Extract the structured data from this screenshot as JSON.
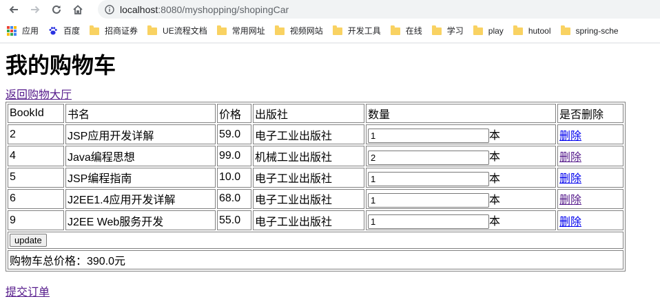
{
  "browser": {
    "url_host": "localhost",
    "url_path": ":8080/myshopping/shopingCar",
    "bookmarks": [
      {
        "label": "应用",
        "icon": "apps-icon"
      },
      {
        "label": "百度",
        "icon": "baidu-paw-icon"
      },
      {
        "label": "招商证券",
        "icon": "folder-icon"
      },
      {
        "label": "UE流程文档",
        "icon": "folder-icon"
      },
      {
        "label": "常用网址",
        "icon": "folder-icon"
      },
      {
        "label": "视频网站",
        "icon": "folder-icon"
      },
      {
        "label": "开发工具",
        "icon": "folder-icon"
      },
      {
        "label": "在线",
        "icon": "folder-icon"
      },
      {
        "label": "学习",
        "icon": "folder-icon"
      },
      {
        "label": "play",
        "icon": "folder-icon"
      },
      {
        "label": "hutool",
        "icon": "folder-icon"
      },
      {
        "label": "spring-sche",
        "icon": "folder-icon"
      }
    ]
  },
  "page": {
    "title": "我的购物车",
    "back_link": "返回购物大厅",
    "submit_link": "提交订单"
  },
  "table": {
    "headers": [
      "BookId",
      "书名",
      "价格",
      "出版社",
      "数量",
      "是否删除"
    ],
    "rows": [
      {
        "id": "2",
        "name": "JSP应用开发详解",
        "price": "59.0",
        "publisher": "电子工业出版社",
        "qty": "1",
        "unit": "本",
        "delete": "删除"
      },
      {
        "id": "4",
        "name": "Java编程思想",
        "price": "99.0",
        "publisher": "机械工业出版社",
        "qty": "2",
        "unit": "本",
        "delete": "删除"
      },
      {
        "id": "5",
        "name": "JSP编程指南",
        "price": "10.0",
        "publisher": "电子工业出版社",
        "qty": "1",
        "unit": "本",
        "delete": "删除"
      },
      {
        "id": "6",
        "name": "J2EE1.4应用开发详解",
        "price": "68.0",
        "publisher": "电子工业出版社",
        "qty": "1",
        "unit": "本",
        "delete": "删除"
      },
      {
        "id": "9",
        "name": "J2EE Web服务开发",
        "price": "55.0",
        "publisher": "电子工业出版社",
        "qty": "1",
        "unit": "本",
        "delete": "删除"
      }
    ],
    "update_label": "update",
    "total_text": "购物车总价格：390.0元"
  },
  "colors": {
    "visited_link": "#551a8b",
    "unvisited_link": "#0000ee",
    "folder": "#f9d262"
  }
}
